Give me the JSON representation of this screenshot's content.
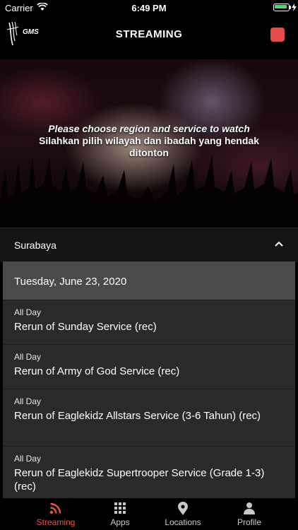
{
  "status_bar": {
    "carrier": "Carrier",
    "time": "6:49 PM"
  },
  "header": {
    "logo_text": "GMS",
    "title": "STREAMING",
    "record_color": "#e64c4c"
  },
  "hero": {
    "line_en": "Please choose region and service to watch",
    "line_id": "Silahkan pilih wilayah dan ibadah yang hendak ditonton"
  },
  "region": {
    "name": "Surabaya",
    "expanded": true
  },
  "schedule": {
    "date": "Tuesday, June 23, 2020",
    "services": [
      {
        "time": "All Day",
        "name": "Rerun of Sunday Service (rec)"
      },
      {
        "time": "All Day",
        "name": "Rerun of Army of God Service (rec)"
      },
      {
        "time": "All Day",
        "name": "Rerun of Eaglekidz Allstars Service (3-6 Tahun) (rec)"
      },
      {
        "time": "All Day",
        "name": "Rerun of Eaglekidz Supertrooper Service (Grade 1-3) (rec)"
      }
    ]
  },
  "tabs": [
    {
      "label": "Streaming",
      "icon": "rss-icon",
      "active": true
    },
    {
      "label": "Apps",
      "icon": "grid-icon",
      "active": false
    },
    {
      "label": "Locations",
      "icon": "map-pin-icon",
      "active": false
    },
    {
      "label": "Profile",
      "icon": "person-icon",
      "active": false
    }
  ],
  "colors": {
    "accent": "#e8553e",
    "battery": "#4cd964"
  }
}
